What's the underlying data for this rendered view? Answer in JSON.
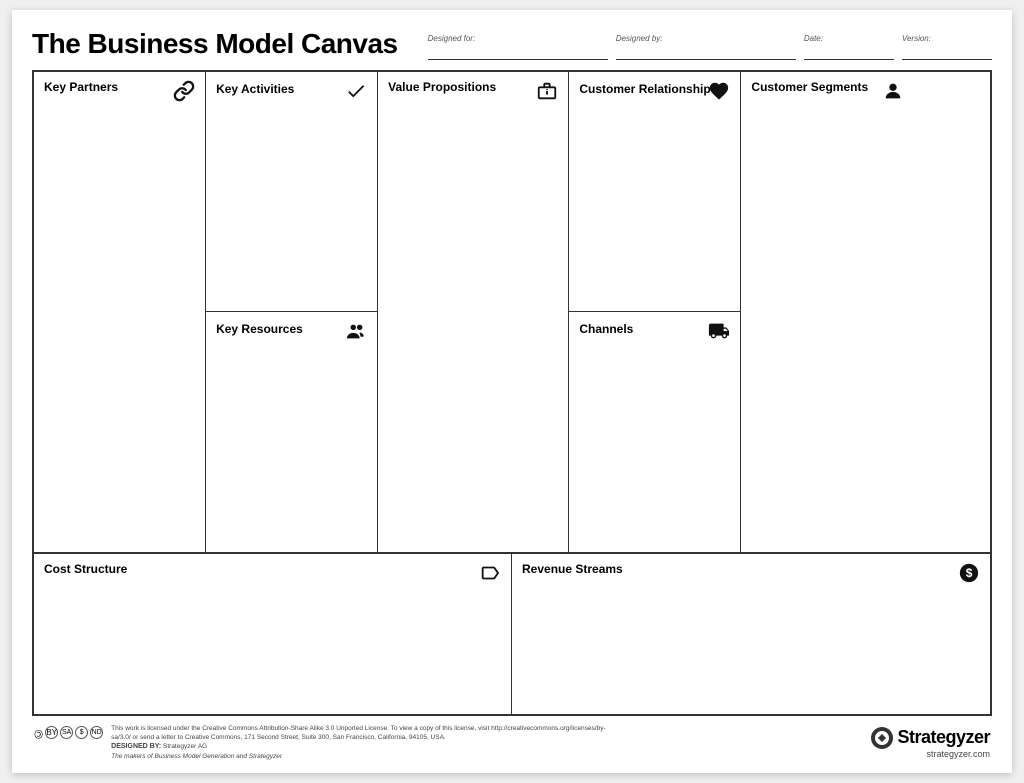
{
  "title": "The Business Model Canvas",
  "header": {
    "designed_for_label": "Designed for:",
    "designed_by_label": "Designed by:",
    "date_label": "Date:",
    "version_label": "Version:"
  },
  "cells": {
    "key_partners": {
      "label": "Key Partners",
      "icon": "link"
    },
    "key_activities": {
      "label": "Key Activities",
      "icon": "checkmark"
    },
    "key_resources": {
      "label": "Key Resources",
      "icon": "people"
    },
    "value_propositions": {
      "label": "Value Propositions",
      "icon": "gift"
    },
    "customer_relationships": {
      "label": "Customer Relationships",
      "icon": "heart"
    },
    "channels": {
      "label": "Channels",
      "icon": "truck"
    },
    "customer_segments": {
      "label": "Customer Segments",
      "icon": "person"
    },
    "cost_structure": {
      "label": "Cost Structure",
      "icon": "tag"
    },
    "revenue_streams": {
      "label": "Revenue Streams",
      "icon": "dollar"
    }
  },
  "footer": {
    "designed_by_prefix": "DESIGNED BY:",
    "designed_by_value": "Strategyzer AG",
    "tagline": "The makers of Business Model Generation and Strategyzer",
    "license_text": "This work is licensed under the Creative Commons Attribution-Share Alike 3.0 Unported License. To view a copy of this license, visit http://creativecommons.org/licenses/by-sa/3.0/ or send a letter to Creative Commons, 171 Second Street, Suite 300, San Francisco, California, 94105, USA.",
    "brand": "Strategyzer",
    "url": "strategyzer.com"
  }
}
